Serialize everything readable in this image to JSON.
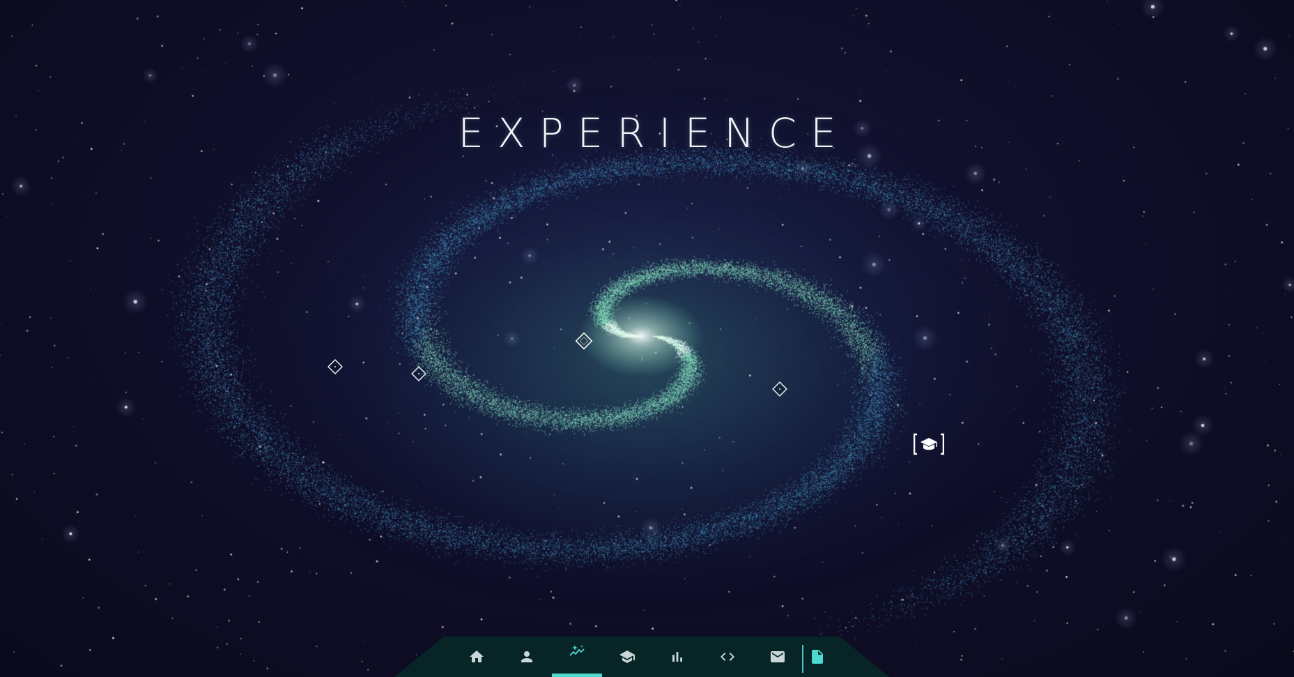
{
  "page": {
    "title": "EXPERIENCE"
  },
  "colors": {
    "background": "#0c0b20",
    "galaxy_core": "#eafff4",
    "galaxy_arm": "#6fe0b8",
    "galaxy_outer": "#3d8fd0",
    "nav_background": "#072526",
    "nav_icon": "#c9d6d6",
    "nav_active": "#4fd8d0"
  },
  "markers": [
    {
      "icon": "diamond-icon",
      "kind": "experience"
    },
    {
      "icon": "diamond-icon",
      "kind": "experience"
    },
    {
      "icon": "diamond-icon",
      "kind": "experience"
    },
    {
      "icon": "diamond-icon",
      "kind": "experience"
    },
    {
      "icon": "graduation-cap-icon",
      "kind": "education"
    }
  ],
  "navbar": {
    "active": "experience",
    "items": [
      {
        "id": "home",
        "icon": "home-icon"
      },
      {
        "id": "about",
        "icon": "person-icon"
      },
      {
        "id": "experience",
        "icon": "sparkle-chart-icon"
      },
      {
        "id": "education",
        "icon": "graduation-cap-icon"
      },
      {
        "id": "skills",
        "icon": "bar-chart-icon"
      },
      {
        "id": "projects",
        "icon": "code-icon"
      },
      {
        "id": "contact",
        "icon": "mail-icon"
      },
      {
        "id": "resume",
        "icon": "document-icon"
      }
    ]
  }
}
